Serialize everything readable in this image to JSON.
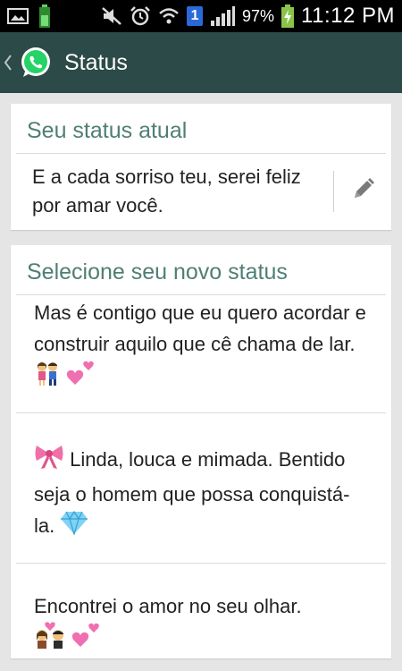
{
  "status_bar": {
    "battery_percent": "97%",
    "time": "11:12 PM",
    "notification_badge": "1",
    "icons": [
      "image-icon",
      "battery-small-icon",
      "mute-icon",
      "alarm-icon",
      "wifi-icon",
      "signal-icon",
      "battery-charging-icon"
    ]
  },
  "action_bar": {
    "title": "Status",
    "logo_color": "#25d366",
    "bar_color": "#2c4a48"
  },
  "current_status": {
    "header": "Seu status atual",
    "text": "E a cada sorriso teu, serei feliz por amar você."
  },
  "new_status": {
    "header": "Selecione seu novo status",
    "items": [
      {
        "text": "Mas é contigo que eu quero acordar e construir aquilo que cê chama de lar.",
        "emoji_icons": [
          "couple-emoji",
          "hearts-emoji"
        ]
      },
      {
        "text": "Linda, louca e mimada. Bentido seja o homem que possa conquistá-la.",
        "emoji_icons": [
          "ribbon-emoji",
          "diamond-emoji"
        ]
      },
      {
        "text": "Encontrei o amor no seu olhar.",
        "emoji_icons": [
          "couple-heart-emoji",
          "hearts-emoji"
        ]
      }
    ]
  },
  "colors": {
    "header_text": "#4f7f74",
    "background": "#e5e5e5"
  }
}
